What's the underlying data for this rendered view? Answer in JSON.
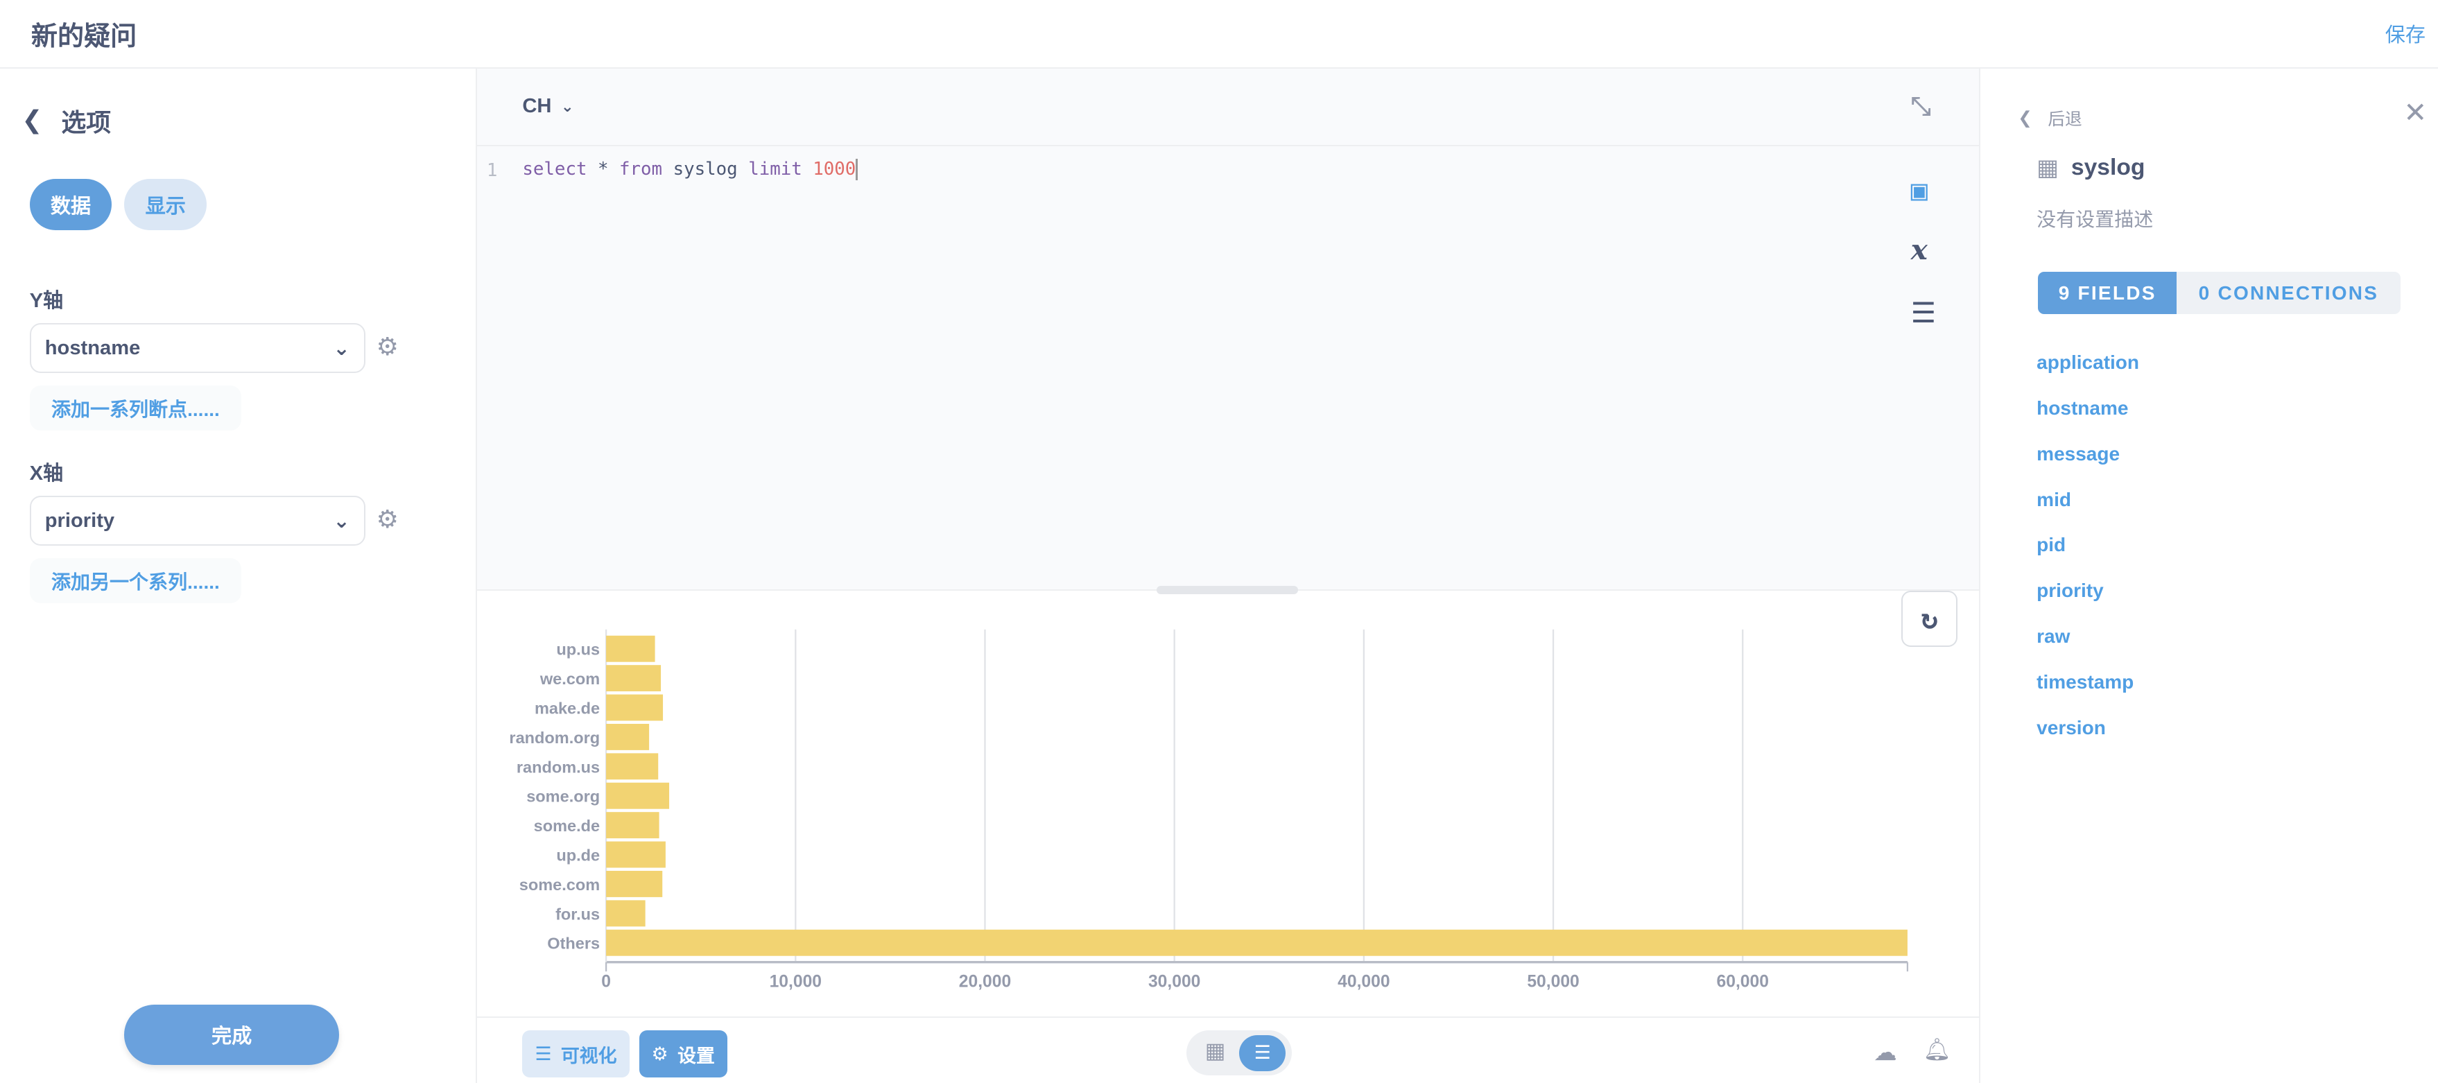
{
  "header": {
    "title": "新的疑问",
    "save_label": "保存"
  },
  "sidebar": {
    "title": "选项",
    "tabs": [
      {
        "label": "数据",
        "active": true
      },
      {
        "label": "显示",
        "active": false
      }
    ],
    "y_axis": {
      "label": "Y轴",
      "value": "hostname",
      "add_label": "添加一系列断点......"
    },
    "x_axis": {
      "label": "X轴",
      "value": "priority",
      "add_label": "添加另一个系列......"
    },
    "done_label": "完成"
  },
  "editor": {
    "database": "CH",
    "line_number": "1",
    "tokens": {
      "k1": "select",
      "t1": " * ",
      "k2": "from",
      "t2": " syslog ",
      "k3": "limit",
      "n1": " 1000"
    }
  },
  "bottom": {
    "visualize_label": "可视化",
    "settings_label": "设置"
  },
  "panel": {
    "back_label": "后退",
    "table_name": "syslog",
    "description": "没有设置描述",
    "fields_tab": "9  FIELDS",
    "connections_tab": "0  CONNECTIONS",
    "fields": [
      "application",
      "hostname",
      "message",
      "mid",
      "pid",
      "priority",
      "raw",
      "timestamp",
      "version"
    ]
  },
  "colors": {
    "accent": "#509ee3",
    "bar": "#f2d372"
  },
  "chart_data": {
    "type": "bar",
    "orientation": "horizontal",
    "categories": [
      "up.us",
      "we.com",
      "make.de",
      "random.org",
      "random.us",
      "some.org",
      "some.de",
      "up.de",
      "some.com",
      "for.us",
      "Others"
    ],
    "values": [
      2580,
      2890,
      3000,
      2270,
      2750,
      3330,
      2800,
      3140,
      2970,
      2070,
      68700
    ],
    "xlim": [
      0,
      68700
    ],
    "ticks": [
      "0",
      "10,000",
      "20,000",
      "30,000",
      "40,000",
      "50,000",
      "60,000"
    ],
    "tick_values": [
      0,
      10000,
      20000,
      30000,
      40000,
      50000,
      60000
    ],
    "grid": true
  }
}
